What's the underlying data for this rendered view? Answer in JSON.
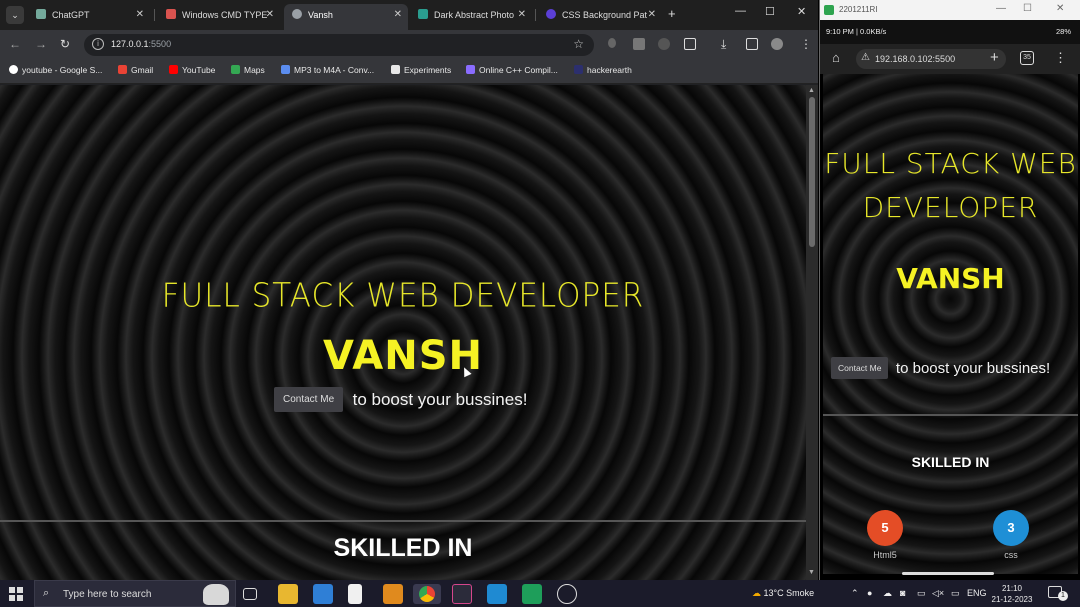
{
  "browser": {
    "tabs": [
      {
        "title": "ChatGPT",
        "color": "#74aa9c"
      },
      {
        "title": "Windows CMD TYPE",
        "color": "#d9534f"
      },
      {
        "title": "Vansh",
        "color": "#9aa0a6"
      },
      {
        "title": "Dark Abstract Photo",
        "color": "#2a9d8f"
      },
      {
        "title": "CSS Background Pat",
        "color": "#5b3fd6"
      }
    ],
    "active_tab_index": 2,
    "url_host": "127.0.0.1",
    "url_port": ":5500",
    "bookmarks": [
      {
        "label": "youtube - Google S...",
        "color": "#ffffff"
      },
      {
        "label": "Gmail",
        "color": "#ea4335"
      },
      {
        "label": "YouTube",
        "color": "#ff0000"
      },
      {
        "label": "Maps",
        "color": "#34a853"
      },
      {
        "label": "MP3 to M4A - Conv...",
        "color": "#5b8def"
      },
      {
        "label": "Experiments",
        "color": "#e8e8e8"
      },
      {
        "label": "Online C++ Compil...",
        "color": "#8a6cff"
      },
      {
        "label": "hackerearth",
        "color": "#2c2f6e"
      }
    ]
  },
  "page": {
    "subtitle": "FULL STACK WEB DEVELOPER",
    "name": "VANSH",
    "contact_button": "Contact Me",
    "cta_text": "to boost your bussines!",
    "skilled_title": "SKILLED IN"
  },
  "phone": {
    "window_title": "2201211RI",
    "status_left": "9:10 PM | 0.0KB/s",
    "status_right": "28%",
    "url": "192.168.0.102:5500",
    "tab_count": "35",
    "subtitle_line1": "FULL STACK WEB",
    "subtitle_line2": "DEVELOPER",
    "name": "VANSH",
    "contact_button": "Contact Me",
    "cta_text": "to boost your bussines!",
    "skilled_title": "SKILLED IN",
    "skills": [
      {
        "label": "Html5",
        "badge": "5",
        "color": "#e44d26"
      },
      {
        "label": "css",
        "badge": "3",
        "color": "#1e8fd6"
      }
    ]
  },
  "taskbar": {
    "search_placeholder": "Type here to search",
    "weather": "13°C  Smoke",
    "language": "ENG",
    "time": "21:10",
    "date": "21-12-2023",
    "notification_count": "1"
  }
}
